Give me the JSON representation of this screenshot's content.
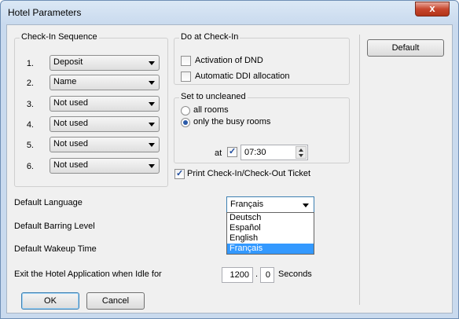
{
  "window": {
    "title": "Hotel Parameters",
    "close_label": "x"
  },
  "checkin_sequence": {
    "title": "Check-In Sequence",
    "items": [
      {
        "num": "1.",
        "value": "Deposit"
      },
      {
        "num": "2.",
        "value": "Name"
      },
      {
        "num": "3.",
        "value": "Not used"
      },
      {
        "num": "4.",
        "value": "Not used"
      },
      {
        "num": "5.",
        "value": "Not used"
      },
      {
        "num": "6.",
        "value": "Not used"
      }
    ]
  },
  "do_at_checkin": {
    "title": "Do at Check-In",
    "activation_dnd": {
      "label": "Activation of DND",
      "checked": false
    },
    "automatic_ddi": {
      "label": "Automatic DDI allocation",
      "checked": false
    }
  },
  "set_uncleaned": {
    "title": "Set to uncleaned",
    "all_rooms": {
      "label": "all rooms",
      "checked": false
    },
    "busy_rooms": {
      "label": "only the busy rooms",
      "checked": true
    },
    "at_label": "at",
    "time_enabled": true,
    "time_value": "07:30"
  },
  "print_ticket": {
    "label": "Print Check-In/Check-Out Ticket",
    "checked": true
  },
  "default_language": {
    "label": "Default Language",
    "value": "Français",
    "options": [
      "Deutsch",
      "Español",
      "English",
      "Français"
    ],
    "selected_index": 3
  },
  "default_barring": {
    "label": "Default Barring Level"
  },
  "default_wakeup": {
    "label": "Default Wakeup Time"
  },
  "idle_exit": {
    "label": "Exit the Hotel Application when Idle for",
    "value_main": "1200",
    "separator": ".",
    "value_frac": "0",
    "unit": "Seconds"
  },
  "buttons": {
    "default": "Default",
    "ok": "OK",
    "cancel": "Cancel"
  },
  "colors": {
    "selection": "#3399ff",
    "close": "#c7472e"
  }
}
